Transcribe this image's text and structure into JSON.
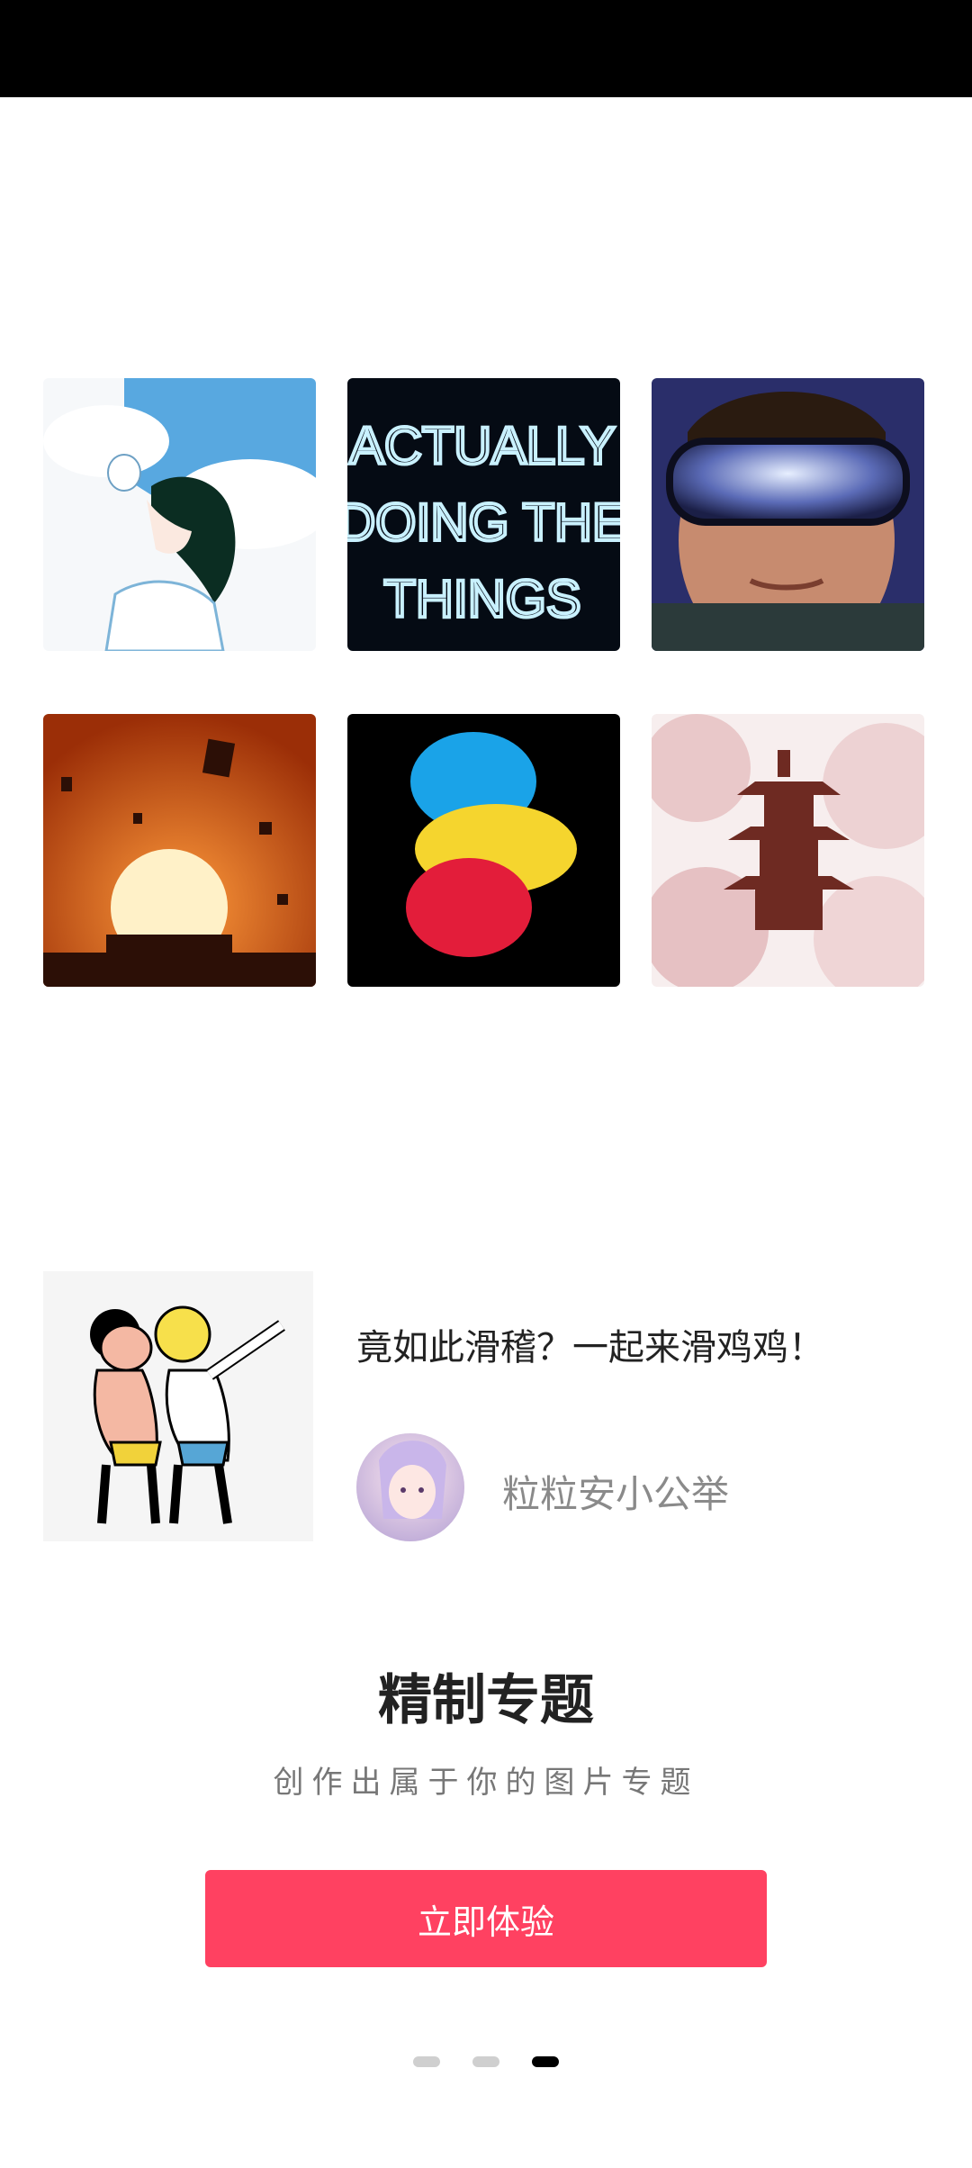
{
  "grid": {
    "images": [
      {
        "name": "anime-girl-sky-image",
        "icon": "illustration-icon"
      },
      {
        "name": "neon-text-image",
        "icon": "neon-text-icon",
        "text": "ACTUALLY DOING THE THINGS"
      },
      {
        "name": "vr-headset-portrait-image",
        "icon": "vr-portrait-icon"
      },
      {
        "name": "sunset-kites-image",
        "icon": "sunset-icon"
      },
      {
        "name": "color-smoke-image",
        "icon": "smoke-icon"
      },
      {
        "name": "pagoda-blossoms-image",
        "icon": "pagoda-icon"
      }
    ]
  },
  "preview": {
    "title": "竟如此滑稽？一起来滑鸡鸡！",
    "author": "粒粒安小公举"
  },
  "headline": "精制专题",
  "subhead": "创作出属于你的图片专题",
  "cta_label": "立即体验",
  "pager": {
    "count": 3,
    "active_index": 2
  },
  "colors": {
    "accent": "#ff4161",
    "status_bar": "#000000"
  }
}
